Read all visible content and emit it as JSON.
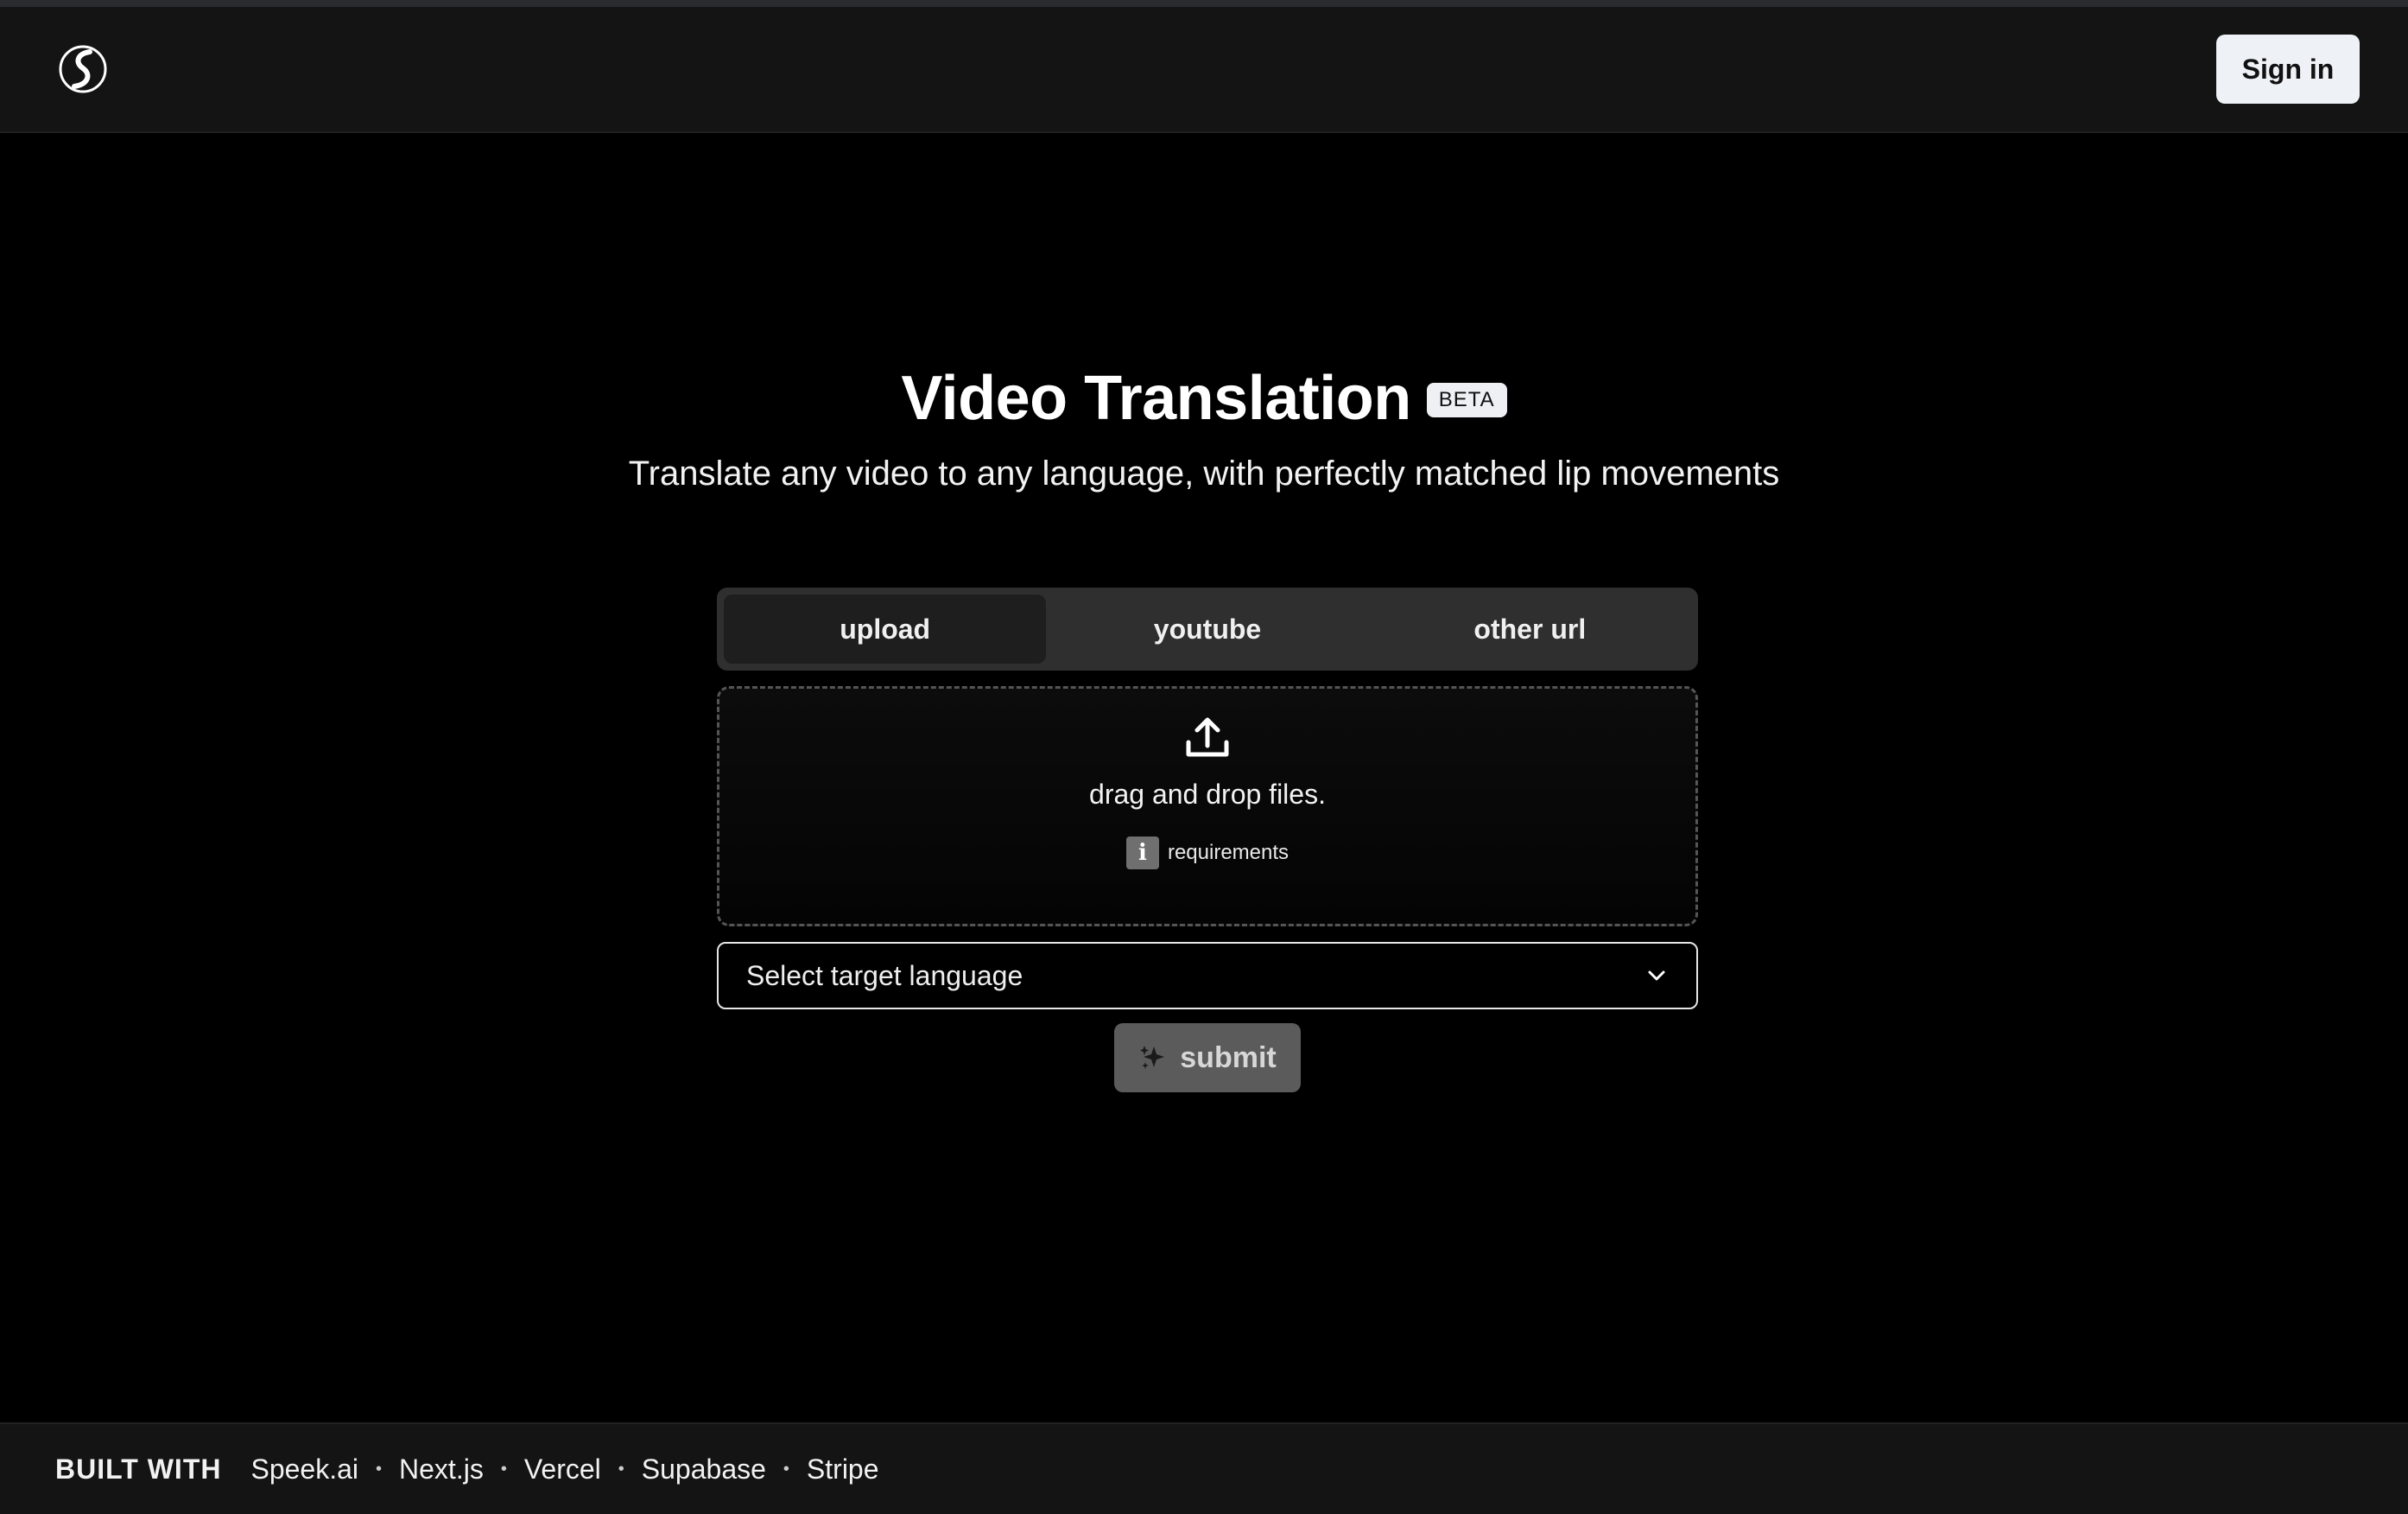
{
  "header": {
    "signin_label": "Sign in"
  },
  "hero": {
    "title": "Video Translation",
    "badge": "BETA",
    "subtitle": "Translate any video to any language, with perfectly matched lip movements"
  },
  "tabs": [
    {
      "label": "upload",
      "active": true
    },
    {
      "label": "youtube",
      "active": false
    },
    {
      "label": "other url",
      "active": false
    }
  ],
  "dropzone": {
    "text": "drag and drop files.",
    "requirements_label": "requirements",
    "icon": "upload-icon"
  },
  "language_select": {
    "placeholder": "Select target language"
  },
  "submit": {
    "label": "submit",
    "icon": "sparkle-icon"
  },
  "footer": {
    "built_with": "BUILT WITH",
    "links": [
      "Speek.ai",
      "Next.js",
      "Vercel",
      "Supabase",
      "Stripe"
    ]
  },
  "colors": {
    "background": "#000000",
    "header_bg": "#141414",
    "tab_bar_bg": "#2f2f2f",
    "tab_active_bg": "#1e1e1e",
    "submit_bg": "#5b5b5b",
    "signin_bg": "#eef1f6"
  }
}
